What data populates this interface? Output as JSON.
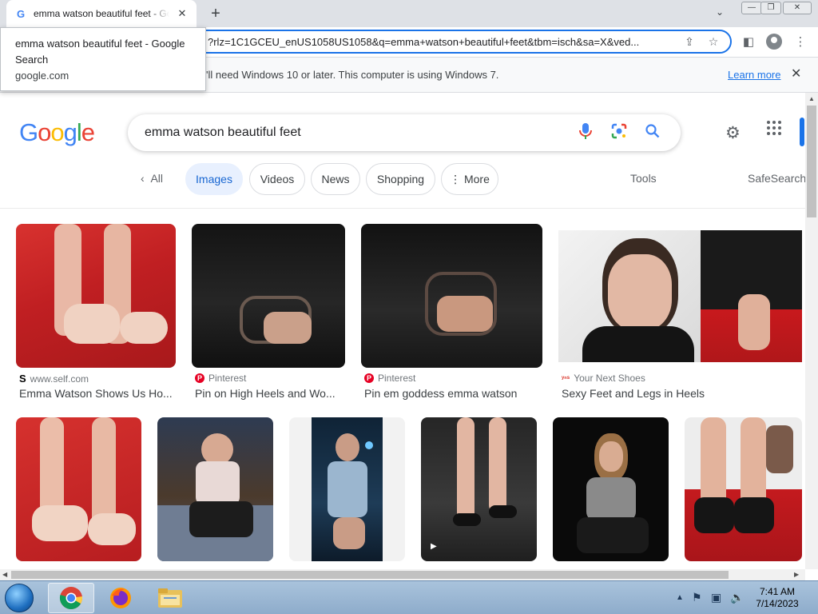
{
  "browser": {
    "tab_title": "emma watson beautiful feet - Google Search",
    "tab_favicon": "G",
    "new_tab": "+",
    "url": "?rlz=1C1GCEU_enUS1058US1058&q=emma+watson+beautiful+feet&tbm=isch&sa=X&ved...",
    "tooltip_title": "emma watson beautiful feet - Google Search",
    "tooltip_domain": "google.com",
    "infobar_message": "'ll need Windows 10 or later. This computer is using Windows 7.",
    "infobar_link": "Learn more"
  },
  "google": {
    "logo": [
      "G",
      "o",
      "o",
      "g",
      "l",
      "e"
    ],
    "logo_colors": [
      "#4285f4",
      "#ea4335",
      "#fbbc05",
      "#4285f4",
      "#34a853",
      "#ea4335"
    ],
    "query": "emma watson beautiful feet",
    "chips": {
      "all": "All",
      "images": "Images",
      "videos": "Videos",
      "news": "News",
      "shopping": "Shopping",
      "more": "More"
    },
    "tools": "Tools",
    "safesearch": "SafeSearch"
  },
  "results_row1": [
    {
      "source": "www.self.com",
      "caption": "Emma Watson Shows Us Ho..."
    },
    {
      "source": "Pinterest",
      "caption": "Pin on High Heels and Wo..."
    },
    {
      "source": "Pinterest",
      "caption": "Pin em goddess emma watson"
    },
    {
      "source": "Your Next Shoes",
      "caption": "Sexy Feet and Legs in Heels"
    }
  ],
  "taskbar": {
    "time": "7:41 AM",
    "date": "7/14/2023"
  },
  "colors": {
    "accent": "#1a73e8",
    "active_chip_bg": "#e8f0fe"
  }
}
